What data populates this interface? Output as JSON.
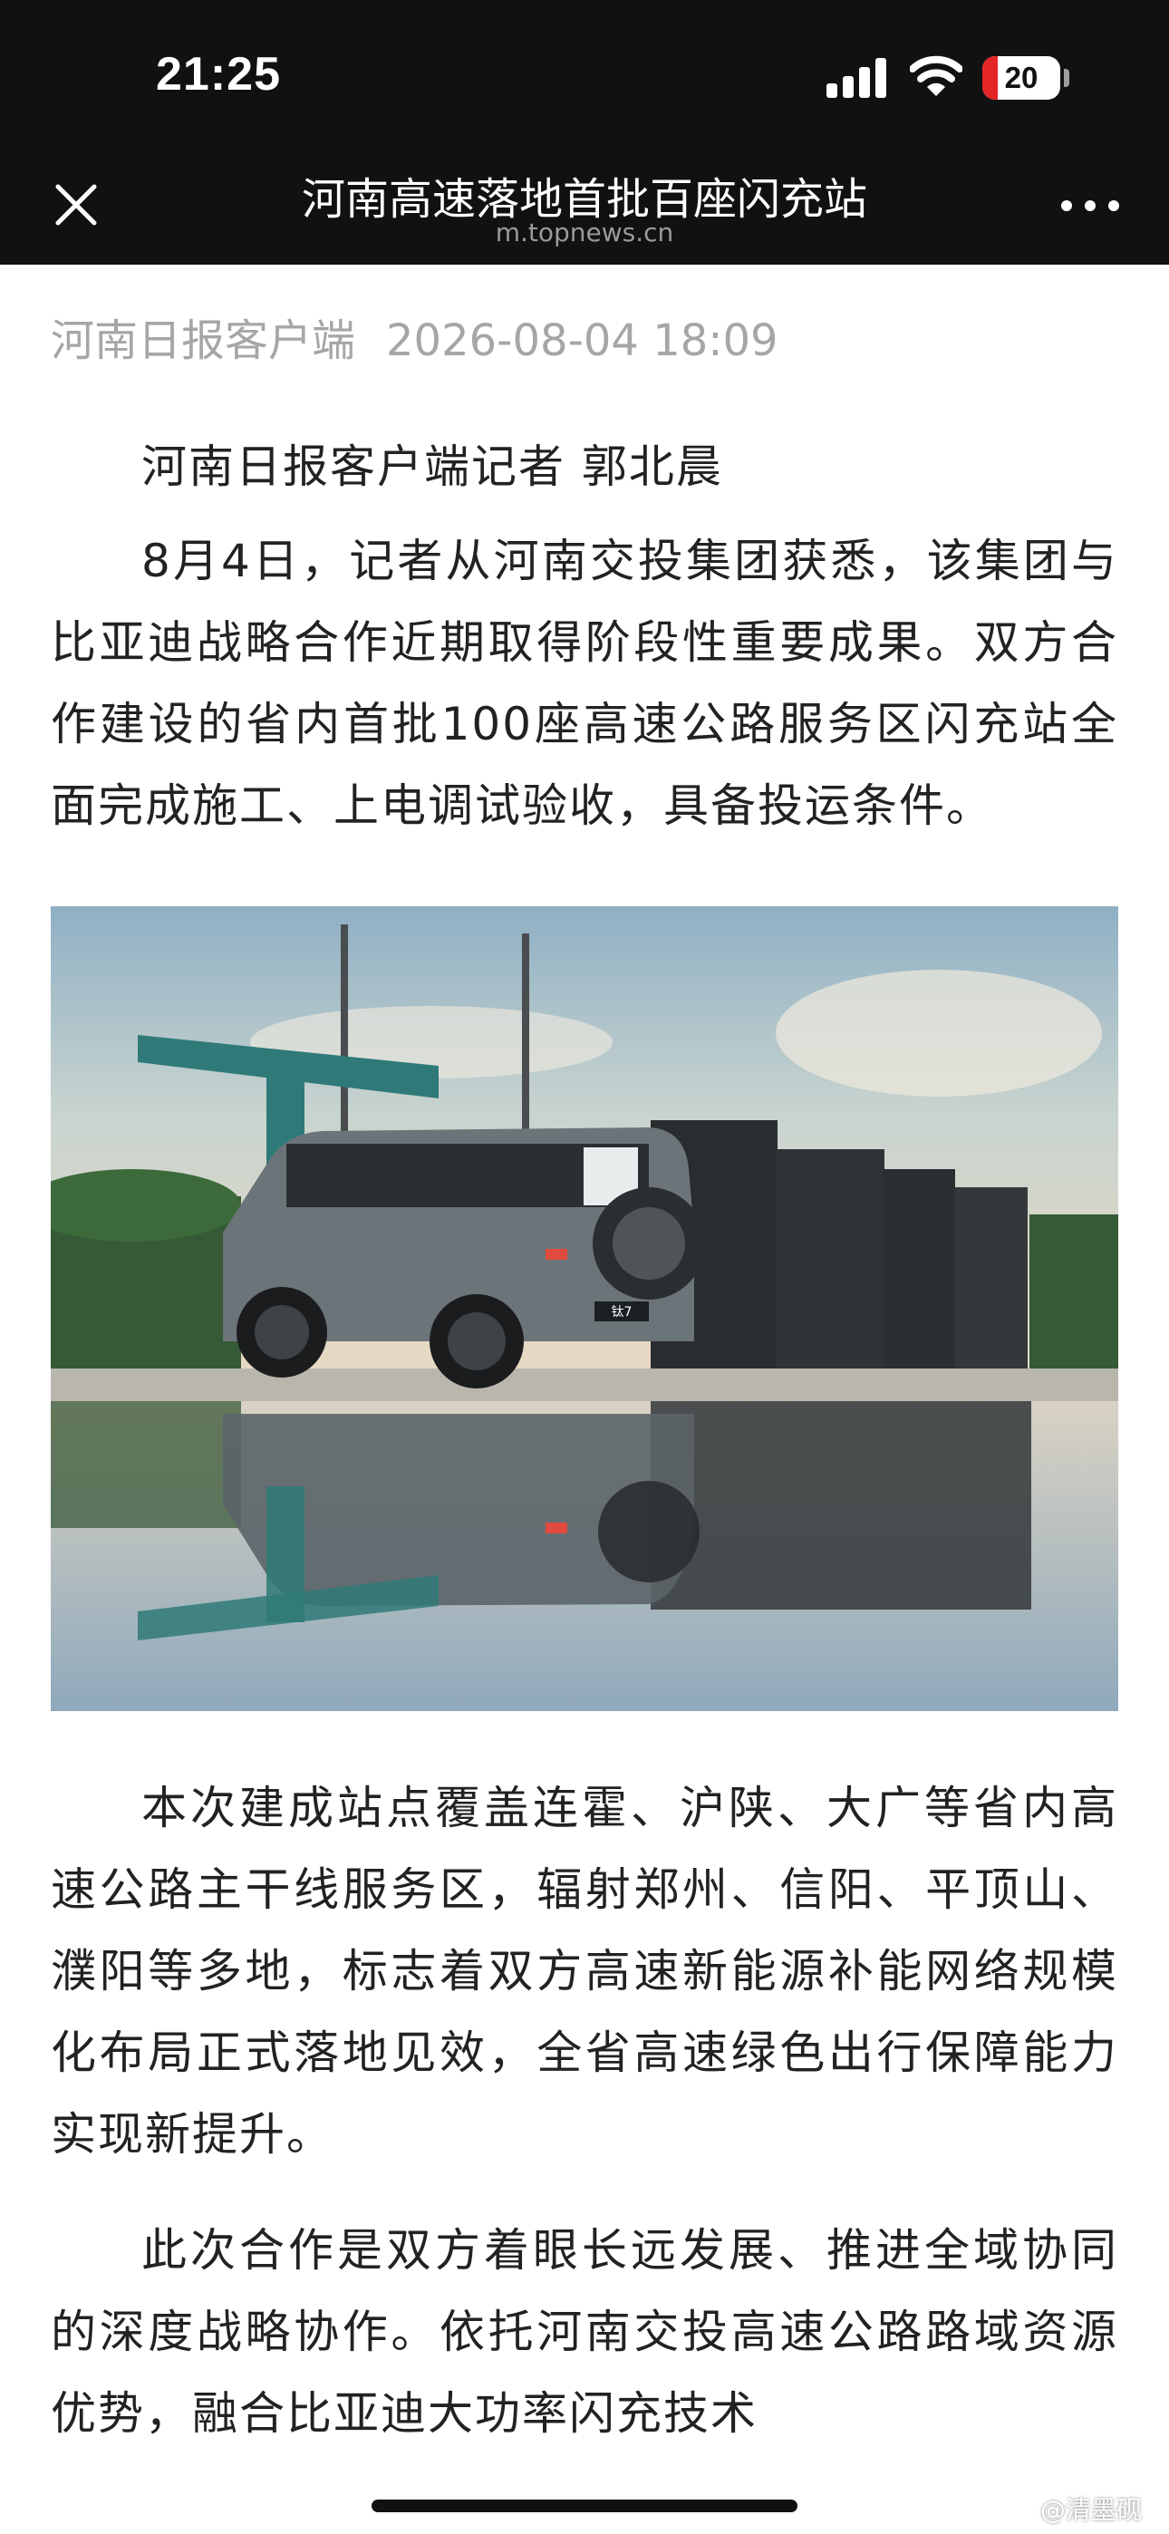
{
  "status_bar": {
    "time": "21:25",
    "battery_level": "20",
    "battery_fraction": 0.2
  },
  "nav": {
    "title": "河南高速落地首批百座闪充站",
    "domain": "m.topnews.cn"
  },
  "article": {
    "source": "河南日报客户端",
    "date": "2026-08-04 18:09",
    "byline": "河南日报客户端记者 郭北晨",
    "paragraphs": [
      "8月4日，记者从河南交投集团获悉，该集团与比亚迪战略合作近期取得阶段性重要成果。双方合作建设的省内首批100座高速公路服务区闪充站全面完成施工、上电调试验收，具备投运条件。",
      "本次建成站点覆盖连霍、沪陕、大广等省内高速公路主干线服务区，辐射郑州、信阳、平顶山、濮阳等多地，标志着双方高速新能源补能网络规模化布局正式落地见效，全省高速绿色出行保障能力实现新提升。",
      "此次合作是双方着眼长远发展、推进全域协同的深度战略协作。依托河南交投高速公路路域资源优势，融合比亚迪大功率闪充技术"
    ],
    "photo": {
      "plate": "钛7"
    }
  },
  "watermark": "@清墨砚",
  "colors": {
    "bar_bg": "#111111",
    "battery_red": "#e32525",
    "meta_gray": "#a6a6a6",
    "body_text": "#222222"
  }
}
